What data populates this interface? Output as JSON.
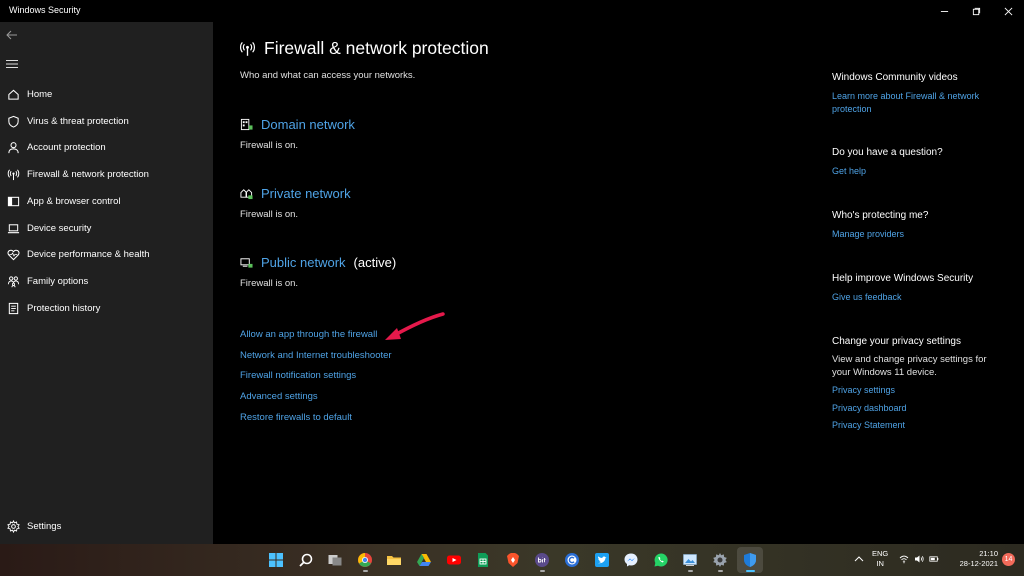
{
  "window": {
    "title": "Windows Security"
  },
  "sidebar": {
    "items": [
      {
        "label": "Home",
        "icon": "home-icon"
      },
      {
        "label": "Virus & threat protection",
        "icon": "shield-icon"
      },
      {
        "label": "Account protection",
        "icon": "person-icon"
      },
      {
        "label": "Firewall & network protection",
        "icon": "antenna-icon"
      },
      {
        "label": "App & browser control",
        "icon": "app-window-icon"
      },
      {
        "label": "Device security",
        "icon": "laptop-icon"
      },
      {
        "label": "Device performance & health",
        "icon": "heart-pulse-icon"
      },
      {
        "label": "Family options",
        "icon": "family-icon"
      },
      {
        "label": "Protection history",
        "icon": "history-icon"
      }
    ],
    "settings_label": "Settings"
  },
  "main": {
    "title": "Firewall & network protection",
    "subtitle": "Who and what can access your networks.",
    "networks": [
      {
        "name": "Domain network",
        "status": "Firewall is on.",
        "active_label": ""
      },
      {
        "name": "Private network",
        "status": "Firewall is on.",
        "active_label": ""
      },
      {
        "name": "Public network",
        "status": "Firewall is on.",
        "active_label": "(active)"
      }
    ],
    "links": [
      "Allow an app through the firewall",
      "Network and Internet troubleshooter",
      "Firewall notification settings",
      "Advanced settings",
      "Restore firewalls to default"
    ]
  },
  "right_panel": {
    "community": {
      "heading": "Windows Community videos",
      "link": "Learn more about Firewall & network protection"
    },
    "question": {
      "heading": "Do you have a question?",
      "link": "Get help"
    },
    "protecting": {
      "heading": "Who's protecting me?",
      "link": "Manage providers"
    },
    "improve": {
      "heading": "Help improve Windows Security",
      "link": "Give us feedback"
    },
    "privacy": {
      "heading": "Change your privacy settings",
      "text": "View and change privacy settings for your Windows 11 device.",
      "links": [
        "Privacy settings",
        "Privacy dashboard",
        "Privacy Statement"
      ]
    }
  },
  "taskbar": {
    "language_top": "ENG",
    "language_bottom": "IN",
    "time": "21:10",
    "date": "28-12-2021",
    "notification_count": "14",
    "apps": [
      "start-icon",
      "search-icon",
      "task-view-icon",
      "chrome-icon",
      "file-explorer-icon",
      "google-drive-icon",
      "youtube-icon",
      "sheets-icon",
      "brave-icon",
      "bit-icon",
      "app-c-icon",
      "twitter-icon",
      "messenger-icon",
      "whatsapp-icon",
      "photo-viewer-icon",
      "settings-gear-icon",
      "windows-security-icon"
    ]
  },
  "colors": {
    "background": "#000000",
    "sidebar": "#202020",
    "link": "#4fa3e6",
    "annotation_arrow": "#e5194b"
  }
}
